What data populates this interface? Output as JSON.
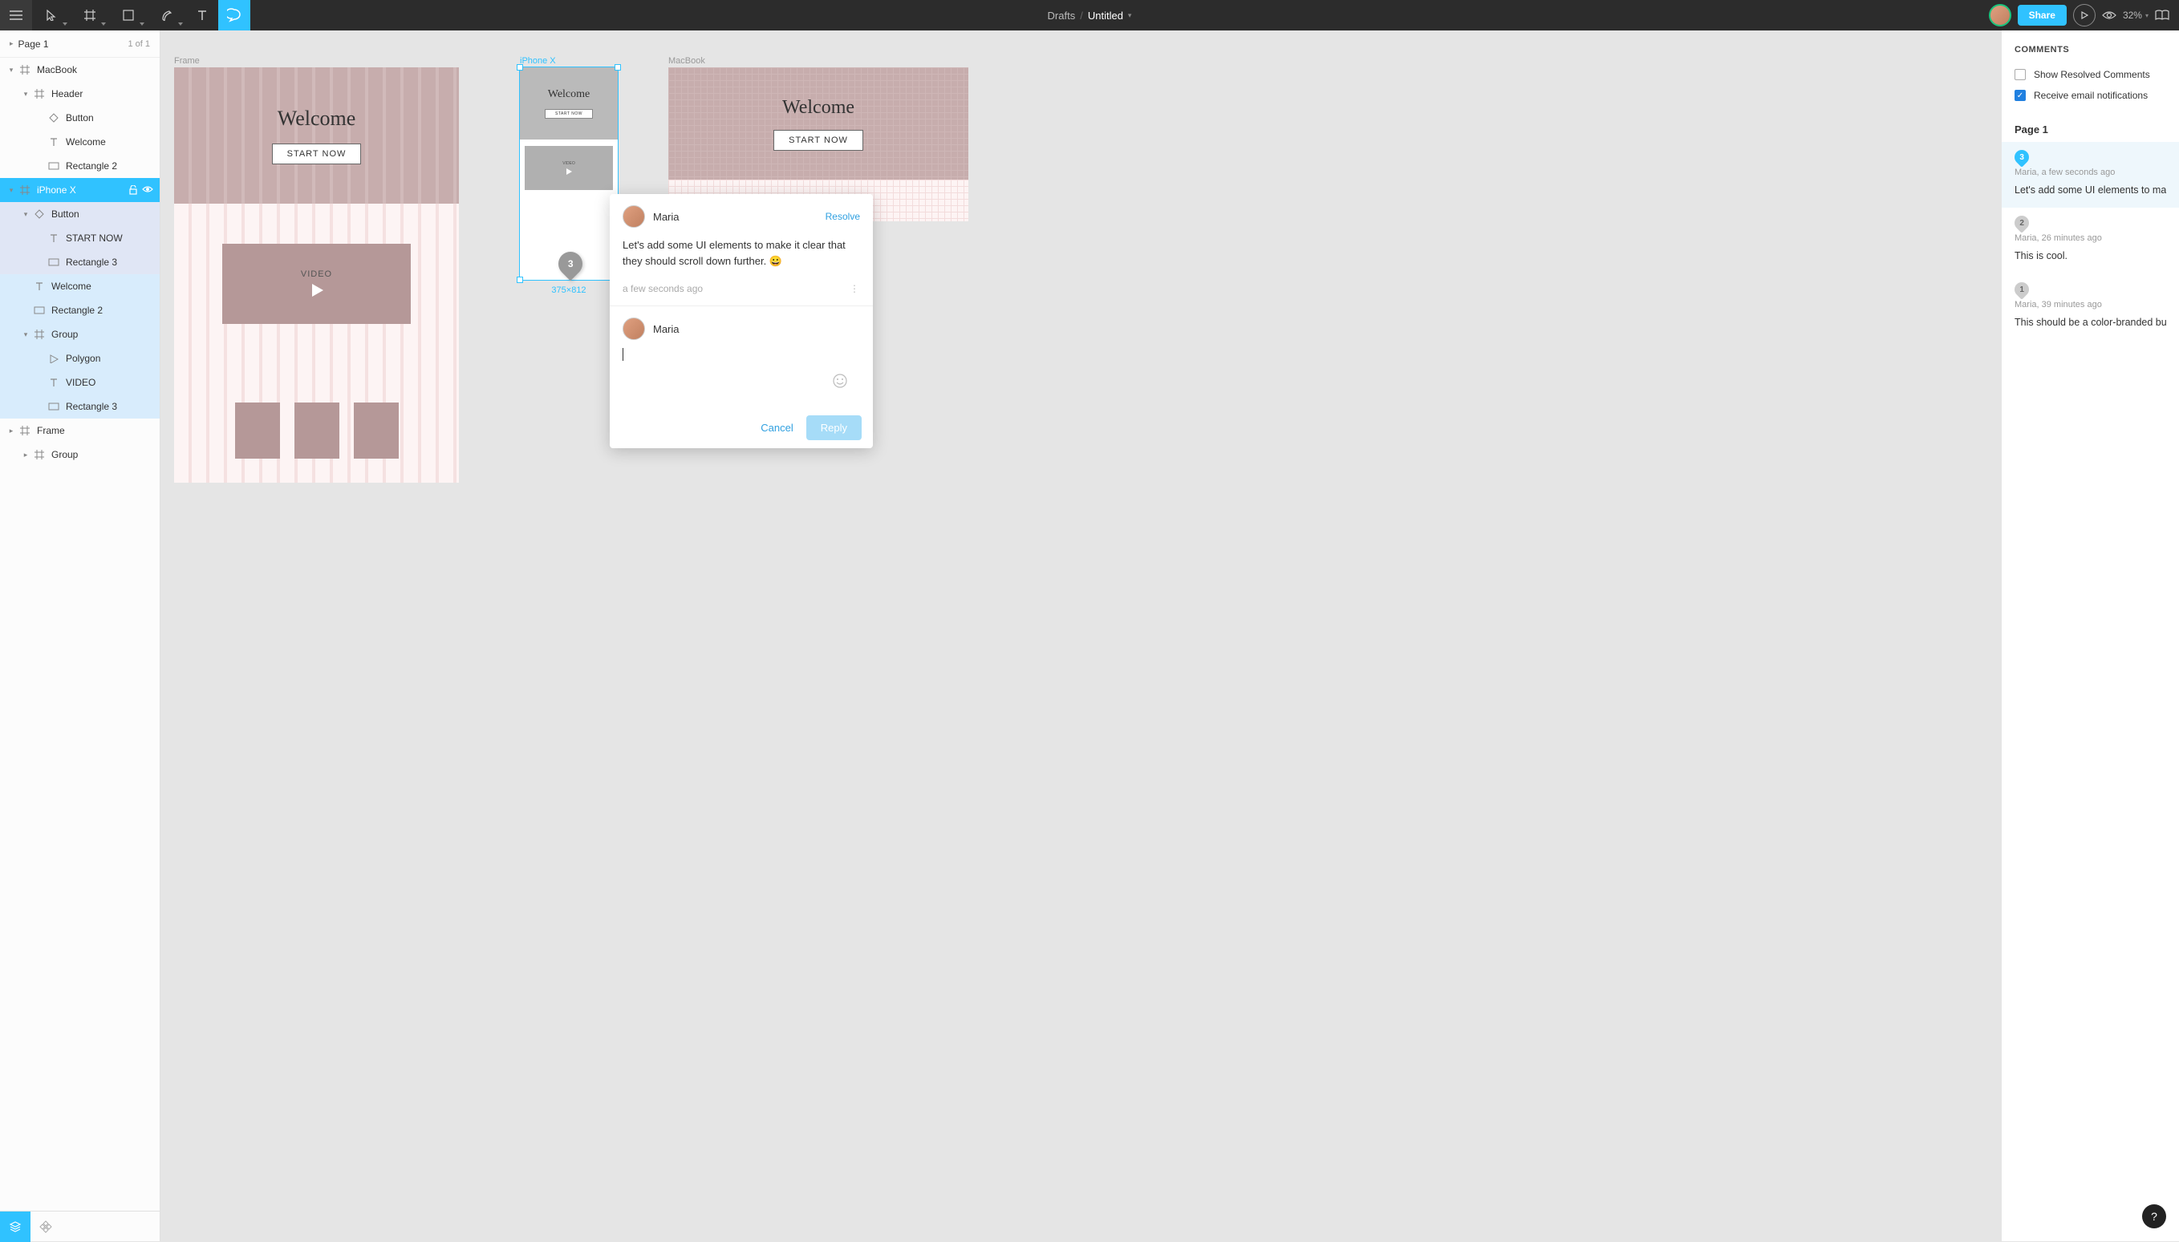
{
  "toolbar": {
    "breadcrumb_root": "Drafts",
    "breadcrumb_sep": "/",
    "doc_name": "Untitled",
    "share_label": "Share",
    "zoom_label": "32%"
  },
  "pages": {
    "current": "Page 1",
    "counter": "1 of 1"
  },
  "layers": [
    {
      "indent": 0,
      "toggle": "down",
      "icon": "frame",
      "label": "MacBook",
      "state": ""
    },
    {
      "indent": 1,
      "toggle": "down",
      "icon": "frame",
      "label": "Header",
      "state": ""
    },
    {
      "indent": 2,
      "toggle": "",
      "icon": "diamond",
      "label": "Button",
      "state": ""
    },
    {
      "indent": 2,
      "toggle": "",
      "icon": "text",
      "label": "Welcome",
      "state": ""
    },
    {
      "indent": 2,
      "toggle": "",
      "icon": "rect",
      "label": "Rectangle 2",
      "state": ""
    },
    {
      "indent": 0,
      "toggle": "down",
      "icon": "frame",
      "label": "iPhone X",
      "state": "selected",
      "actions": true
    },
    {
      "indent": 1,
      "toggle": "down",
      "icon": "diamond",
      "label": "Button",
      "state": "child-sel"
    },
    {
      "indent": 2,
      "toggle": "",
      "icon": "text",
      "label": "START NOW",
      "state": "child-sel"
    },
    {
      "indent": 2,
      "toggle": "",
      "icon": "rect",
      "label": "Rectangle 3",
      "state": "child-sel"
    },
    {
      "indent": 1,
      "toggle": "",
      "icon": "text",
      "label": "Welcome",
      "state": "group-sel"
    },
    {
      "indent": 1,
      "toggle": "",
      "icon": "rect",
      "label": "Rectangle 2",
      "state": "group-sel"
    },
    {
      "indent": 1,
      "toggle": "down",
      "icon": "frame",
      "label": "Group",
      "state": "group-sel"
    },
    {
      "indent": 2,
      "toggle": "",
      "icon": "polygon",
      "label": "Polygon",
      "state": "group-sel"
    },
    {
      "indent": 2,
      "toggle": "",
      "icon": "text",
      "label": "VIDEO",
      "state": "group-sel"
    },
    {
      "indent": 2,
      "toggle": "",
      "icon": "rect",
      "label": "Rectangle 3",
      "state": "group-sel"
    },
    {
      "indent": 0,
      "toggle": "right",
      "icon": "frame",
      "label": "Frame",
      "state": ""
    },
    {
      "indent": 1,
      "toggle": "right",
      "icon": "frame",
      "label": "Group",
      "state": ""
    }
  ],
  "canvas": {
    "frames": [
      {
        "name": "Frame",
        "welcome": "Welcome",
        "button": "START NOW",
        "video": "VIDEO"
      },
      {
        "name": "iPhone X",
        "welcome": "Welcome",
        "button": "START NOW",
        "video": "VIDEO",
        "selected": true,
        "dims": "375×812"
      },
      {
        "name": "MacBook",
        "welcome": "Welcome",
        "button": "START NOW"
      }
    ],
    "comment_pin_number": "3"
  },
  "comment_popup": {
    "author": "Maria",
    "resolve": "Resolve",
    "body": "Let's add some UI elements to make it clear that they should scroll down further. 😀",
    "meta": "a few seconds ago",
    "reply_author": "Maria",
    "cancel": "Cancel",
    "reply": "Reply"
  },
  "comments_panel": {
    "title": "COMMENTS",
    "opt_resolved": "Show Resolved Comments",
    "opt_email": "Receive email notifications",
    "page_label": "Page 1",
    "items": [
      {
        "num": "3",
        "meta": "Maria, a few seconds ago",
        "text": "Let's add some UI elements to make it",
        "active": true,
        "color": "#30c2ff"
      },
      {
        "num": "2",
        "meta": "Maria, 26 minutes ago",
        "text": "This is cool.",
        "active": false,
        "color": "#ccc"
      },
      {
        "num": "1",
        "meta": "Maria, 39 minutes ago",
        "text": "This should be a color-branded button",
        "active": false,
        "color": "#ccc"
      }
    ]
  },
  "help": "?"
}
